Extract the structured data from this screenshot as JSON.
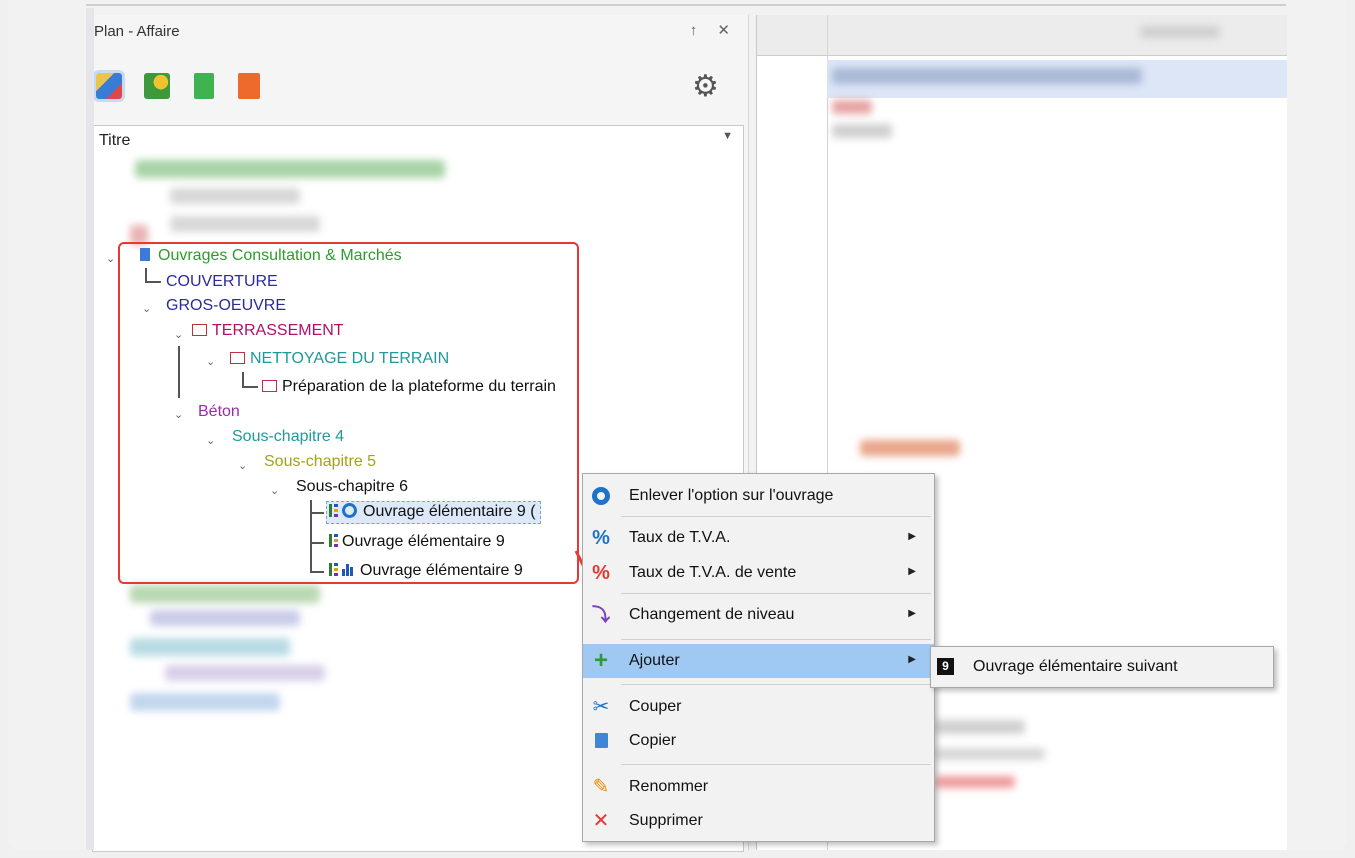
{
  "panel": {
    "title": "Plan - Affaire",
    "controls": "↑ ✕"
  },
  "toolbar": {
    "icons": [
      "plan-icon",
      "money-icon",
      "document-icon",
      "contact-icon"
    ],
    "settings_icon": "gear-icon"
  },
  "tree": {
    "column_header": "Titre",
    "nodes": {
      "ouvrages": "Ouvrages Consultation & Marchés",
      "couverture": "COUVERTURE",
      "gros_oeuvre": "GROS-OEUVRE",
      "terrassement": "TERRASSEMENT",
      "nettoyage": "NETTOYAGE DU TERRAIN",
      "preparation": "Préparation de la plateforme du terrain",
      "beton": "Béton",
      "sous4": "Sous-chapitre 4",
      "sous5": "Sous-chapitre 5",
      "sous6": "Sous-chapitre 6",
      "ouvrage_a": "Ouvrage élémentaire 9 (",
      "ouvrage_b": "Ouvrage élémentaire 9",
      "ouvrage_c": "Ouvrage élémentaire 9"
    }
  },
  "context_menu": {
    "items": [
      {
        "label": "Enlever l'option sur l'ouvrage",
        "icon": "circle-icon",
        "submenu": false
      },
      {
        "label": "Taux de T.V.A.",
        "icon": "percent-icon",
        "submenu": true
      },
      {
        "label": "Taux de T.V.A. de vente",
        "icon": "percent-red-icon",
        "submenu": true
      },
      {
        "label": "Changement de niveau",
        "icon": "level-change-icon",
        "submenu": true
      },
      {
        "label": "Ajouter",
        "icon": "plus-icon",
        "submenu": true
      },
      {
        "label": "Couper",
        "icon": "scissors-icon",
        "submenu": false
      },
      {
        "label": "Copier",
        "icon": "copy-icon",
        "submenu": false
      },
      {
        "label": "Renommer",
        "icon": "pencil-icon",
        "submenu": false
      },
      {
        "label": "Supprimer",
        "icon": "delete-icon",
        "submenu": false
      }
    ],
    "highlighted": "Ajouter"
  },
  "submenu": {
    "badge": "9",
    "label": "Ouvrage élémentaire suivant"
  },
  "colors": {
    "green_node": "#2e9b2e",
    "navy_node": "#2b2b9a",
    "crimson_node": "#b0106a",
    "teal_node": "#1f9a9a",
    "purple_node": "#9a2bb0",
    "olive_node": "#a3a310",
    "highlight": "#9fc9f2",
    "annotation": "#e53935"
  }
}
